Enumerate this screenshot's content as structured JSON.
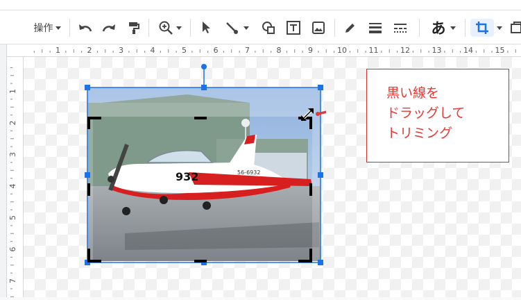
{
  "toolbar": {
    "operations_label": "操作",
    "text_style_glyph": "あ",
    "buttons": [
      {
        "name": "operations-menu",
        "icon": "caret-down-icon"
      },
      {
        "name": "undo",
        "icon": "undo-icon"
      },
      {
        "name": "redo",
        "icon": "redo-icon"
      },
      {
        "name": "paint-format",
        "icon": "paint-roller-icon"
      },
      {
        "name": "zoom",
        "icon": "zoom-in-icon"
      },
      {
        "name": "select",
        "icon": "cursor-arrow-icon"
      },
      {
        "name": "line",
        "icon": "line-icon"
      },
      {
        "name": "shape",
        "icon": "shape-icon"
      },
      {
        "name": "text-box",
        "icon": "text-box-icon"
      },
      {
        "name": "image",
        "icon": "image-icon"
      },
      {
        "name": "pen",
        "icon": "pen-icon"
      },
      {
        "name": "line-weight",
        "icon": "line-weight-icon"
      },
      {
        "name": "line-dash",
        "icon": "line-dash-icon"
      },
      {
        "name": "text-style",
        "icon": "text-style-icon"
      },
      {
        "name": "crop",
        "icon": "crop-icon",
        "active": true
      },
      {
        "name": "reset-image",
        "icon": "reset-image-icon"
      }
    ]
  },
  "ruler": {
    "horizontal_numbers": [
      "1",
      "2",
      "3",
      "4",
      "5",
      "6",
      "7",
      "8",
      "9",
      "10",
      "11",
      "12",
      "13",
      "14",
      "15"
    ],
    "vertical_numbers": [
      "1",
      "2",
      "3",
      "4",
      "5",
      "6",
      "7"
    ]
  },
  "image": {
    "aircraft_registration": "932",
    "tail_marking": "56-6932"
  },
  "callout": {
    "lines": [
      "黒い線を",
      "ドラッグして",
      "トリミング"
    ]
  },
  "colors": {
    "accent_blue": "#1a73e8",
    "callout_red": "#e53935",
    "crop_handle": "#000000"
  }
}
